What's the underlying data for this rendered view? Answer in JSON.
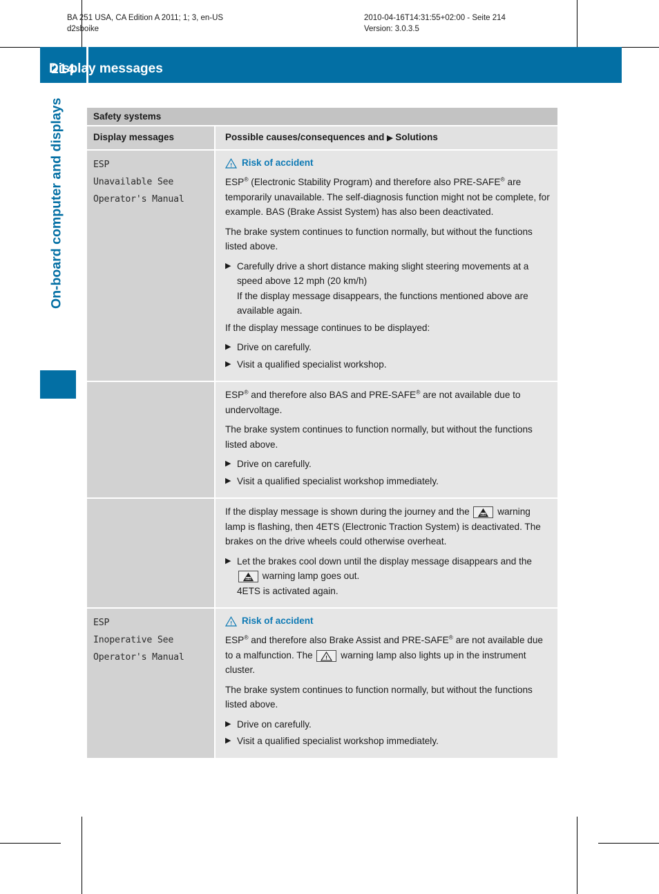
{
  "print_header": {
    "left_line1": "BA 251 USA, CA Edition A 2011; 1; 3, en-US",
    "left_line2": "d2sboike",
    "right_line1": "2010-04-16T14:31:55+02:00 - Seite 214",
    "right_line2": "Version: 3.0.3.5"
  },
  "header": {
    "page_number": "214",
    "title": "Display messages",
    "accent_color": "#036fa4"
  },
  "chapter": {
    "label": "On-board computer and displays"
  },
  "table": {
    "section_title": "Safety systems",
    "columns": {
      "left": "Display messages",
      "right_prefix": "Possible causes/consequences and",
      "right_suffix": "Solutions",
      "right_marker": "▶"
    },
    "bullet_marker": "▶",
    "rows": [
      {
        "message": "ESP\nUnavailable See\nOperator's Manual",
        "warning": {
          "icon": "warning-triangle-icon",
          "title": "Risk of accident"
        },
        "blocks": [
          {
            "type": "paragraph",
            "text_parts": [
              {
                "t": "ESP"
              },
              {
                "sup": "®"
              },
              {
                "t": " (Electronic Stability Program) and therefore also PRE-SAFE"
              },
              {
                "sup": "®"
              },
              {
                "t": " are temporarily unavailable. The self-diagnosis function might not be complete, for example. BAS (Brake Assist System) has also been deactivated."
              }
            ]
          },
          {
            "type": "paragraph",
            "text_parts": [
              {
                "t": "The brake system continues to function normally, but without the functions listed above."
              }
            ]
          },
          {
            "type": "bullet",
            "text_parts": [
              {
                "t": "Carefully drive a short distance making slight steering movements at a speed above 12 mph (20 km/h)"
              }
            ],
            "sub_lines": [
              "If the display message disappears, the functions mentioned above are available again."
            ]
          },
          {
            "type": "paragraph",
            "text_parts": [
              {
                "t": "If the display message continues to be displayed:"
              }
            ]
          },
          {
            "type": "bullet",
            "text_parts": [
              {
                "t": "Drive on carefully."
              }
            ]
          },
          {
            "type": "bullet",
            "text_parts": [
              {
                "t": "Visit a qualified specialist workshop."
              }
            ]
          }
        ]
      },
      {
        "message": "",
        "warning": null,
        "blocks": [
          {
            "type": "paragraph",
            "text_parts": [
              {
                "t": "ESP"
              },
              {
                "sup": "®"
              },
              {
                "t": " and therefore also BAS and PRE-SAFE"
              },
              {
                "sup": "®"
              },
              {
                "t": " are not available due to undervoltage."
              }
            ]
          },
          {
            "type": "paragraph",
            "text_parts": [
              {
                "t": "The brake system continues to function normally, but without the functions listed above."
              }
            ]
          },
          {
            "type": "bullet",
            "text_parts": [
              {
                "t": "Drive on carefully."
              }
            ]
          },
          {
            "type": "bullet",
            "text_parts": [
              {
                "t": "Visit a qualified specialist workshop immediately."
              }
            ]
          }
        ]
      },
      {
        "message": "",
        "warning": null,
        "blocks": [
          {
            "type": "paragraph",
            "text_parts": [
              {
                "t": "If the display message is shown during the journey and the "
              },
              {
                "icon": "traction-control-lamp-icon"
              },
              {
                "t": " warning lamp is flashing, then 4ETS (Electronic Traction System) is deactivated. The brakes on the drive wheels could otherwise overheat."
              }
            ]
          },
          {
            "type": "bullet",
            "text_parts": [
              {
                "t": "Let the brakes cool down until the display message disappears and the "
              },
              {
                "icon": "traction-control-lamp-icon"
              },
              {
                "t": " warning lamp goes out."
              }
            ],
            "sub_lines": [
              "4ETS is activated again."
            ]
          }
        ]
      },
      {
        "message": "ESP\nInoperative See\nOperator's Manual",
        "warning": {
          "icon": "warning-triangle-icon",
          "title": "Risk of accident"
        },
        "blocks": [
          {
            "type": "paragraph",
            "text_parts": [
              {
                "t": "ESP"
              },
              {
                "sup": "®"
              },
              {
                "t": " and therefore also Brake Assist and PRE-SAFE"
              },
              {
                "sup": "®"
              },
              {
                "t": " are not available due to a malfunction. The "
              },
              {
                "icon": "warning-lamp-triangle-icon"
              },
              {
                "t": " warning lamp also lights up in the instrument cluster."
              }
            ]
          },
          {
            "type": "paragraph",
            "text_parts": [
              {
                "t": "The brake system continues to function normally, but without the functions listed above."
              }
            ]
          },
          {
            "type": "bullet",
            "text_parts": [
              {
                "t": "Drive on carefully."
              }
            ]
          },
          {
            "type": "bullet",
            "text_parts": [
              {
                "t": "Visit a qualified specialist workshop immediately."
              }
            ]
          }
        ]
      }
    ]
  }
}
